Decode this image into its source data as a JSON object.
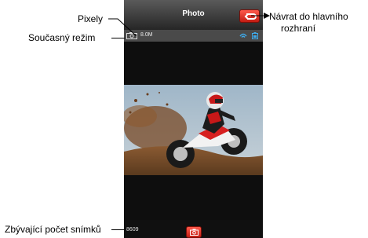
{
  "app": {
    "title": "Photo",
    "resolution": "8.0M",
    "shots_remaining": "8609",
    "mode_icon": "camera-mode-icon",
    "back_icon": "return-arrow-icon",
    "shutter_icon": "camera-icon",
    "accent_color": "#e53a2e"
  },
  "annotations": {
    "pixels": "Pixely",
    "current_mode": "Současný režim",
    "return_line1": "Návrat do hlavního",
    "return_line2": "rozhraní",
    "shots_left": "Zbývající počet snímků"
  }
}
